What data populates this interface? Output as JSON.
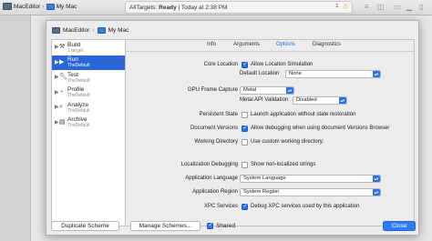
{
  "toolbar": {
    "app_name": "MacEditor",
    "destination": "My Mac",
    "status_prefix": "AllTargets:",
    "status_state": "Ready",
    "status_time": "| Today at 2:38 PM",
    "warning_count": "1"
  },
  "sheet": {
    "app_name": "MacEditor",
    "destination": "My Mac",
    "actions": [
      {
        "name": "Build",
        "sub": "1 target"
      },
      {
        "name": "Run",
        "sub": "TheDefault"
      },
      {
        "name": "Test",
        "sub": "TheDefault"
      },
      {
        "name": "Profile",
        "sub": "TheDefault"
      },
      {
        "name": "Analyze",
        "sub": "TheDefault"
      },
      {
        "name": "Archive",
        "sub": "TheDefault"
      }
    ],
    "selected_action": "Run",
    "tabs": [
      "Info",
      "Arguments",
      "Options",
      "Diagnostics"
    ],
    "active_tab": "Options"
  },
  "options": {
    "core_location_label": "Core Location",
    "allow_location_label": "Allow Location Simulation",
    "allow_location_checked": true,
    "default_location_label": "Default Location",
    "default_location_value": "None",
    "gpu_label": "GPU Frame Capture",
    "gpu_value": "Metal",
    "metal_api_label": "Metal API Validation",
    "metal_api_value": "Disabled",
    "persistent_label": "Persistent State",
    "persistent_text": "Launch application without state restoration",
    "persistent_checked": false,
    "doc_versions_label": "Document Versions",
    "doc_versions_text": "Allow debugging when using document Versions Browser",
    "doc_versions_checked": true,
    "workdir_label": "Working Directory",
    "workdir_text": "Use custom working directory:",
    "workdir_checked": false,
    "localization_label": "Localization Debugging",
    "localization_text": "Show non-localized strings",
    "localization_checked": false,
    "app_language_label": "Application Language",
    "app_language_value": "System Language",
    "app_region_label": "Application Region",
    "app_region_value": "System Region",
    "xpc_label": "XPC Services",
    "xpc_text": "Debug XPC services used by this application",
    "xpc_checked": true
  },
  "footer": {
    "duplicate_label": "Duplicate Scheme",
    "manage_label": "Manage Schemes...",
    "shared_label": "Shared",
    "shared_checked": true,
    "close_label": "Close"
  },
  "colors": {
    "accent": "#2b66d7",
    "checkbox_on": "#2b72e6",
    "warning": "#e8a21a"
  }
}
